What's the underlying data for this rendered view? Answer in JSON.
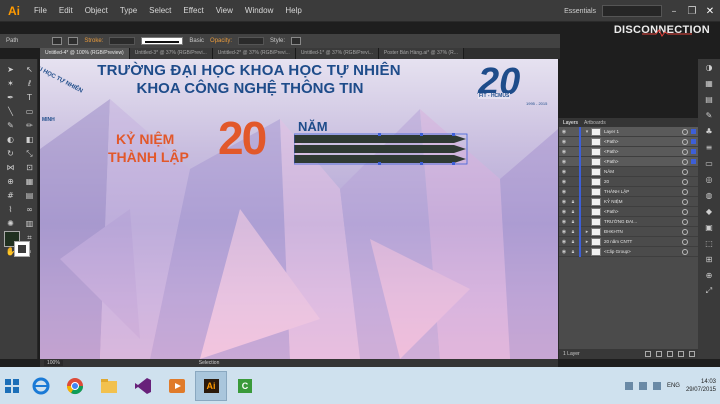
{
  "app": {
    "logo": "Ai",
    "menu": [
      "File",
      "Edit",
      "Object",
      "Type",
      "Select",
      "Effect",
      "View",
      "Window",
      "Help"
    ],
    "workspace": "Essentials",
    "overlay_brand": "DISCONNECTION"
  },
  "control_bar": {
    "object_type": "Path",
    "stroke_label": "Stroke:",
    "stroke_profile": "Basic",
    "opacity_label": "Opacity:",
    "style_label": "Style:"
  },
  "tabs": [
    {
      "label": "Untitled-4* @ 100% (RGB/Preview)",
      "active": true
    },
    {
      "label": "Untitled-3* @ 37% (RGB/Previ...",
      "active": false
    },
    {
      "label": "Untitled-2* @ 37% (RGB/Previ...",
      "active": false
    },
    {
      "label": "Untitled-1* @ 37% (RGB/Previ...",
      "active": false
    },
    {
      "label": "Poster Bán Hàng.ai* @ 37% (R...",
      "active": false
    }
  ],
  "canvas": {
    "seal_text": "ĐẠI HỌC TỰ NHIÊN",
    "seal_text2": "MINH",
    "university": "TRƯỜNG ĐẠI HỌC KHOA HỌC TỰ NHIÊN",
    "faculty": "KHOA CÔNG NGHỆ THÔNG TIN",
    "anniv_line1": "KỶ NIỆM",
    "anniv_line2": "THÀNH LẬP",
    "big_number": "20",
    "nam": "NĂM",
    "logo_number": "20",
    "logo_sub": "FIT - HCMUS",
    "logo_years": "1995 - 2015"
  },
  "status_bar": {
    "zoom": "100%",
    "tool": "Selection"
  },
  "layers_panel": {
    "tabs": [
      "Layers",
      "Artboards"
    ],
    "rows": [
      {
        "name": "Layer 1",
        "selected": true
      },
      {
        "name": "<Path>",
        "selected": true
      },
      {
        "name": "<Path>",
        "selected": true
      },
      {
        "name": "<Path>",
        "selected": true
      },
      {
        "name": "NĂM",
        "selected": false
      },
      {
        "name": "20",
        "selected": false
      },
      {
        "name": "THÀNH LẬP",
        "selected": false
      },
      {
        "name": "KỶ NIỆM",
        "selected": false
      },
      {
        "name": "<Path>",
        "selected": false
      },
      {
        "name": "TRƯỜNG ĐAI...",
        "selected": false
      },
      {
        "name": "ĐHKHTN",
        "selected": false
      },
      {
        "name": "20 năm CNTT",
        "selected": false
      },
      {
        "name": "<Clip Group>",
        "selected": false
      }
    ],
    "footer_count": "1 Layer"
  },
  "taskbar": {
    "apps": [
      "IE",
      "Chrome",
      "Explorer",
      "VS",
      "Media",
      "Ai",
      "C"
    ],
    "language": "ENG",
    "time": "14:03",
    "date": "29/07/2015"
  },
  "colors": {
    "ui_dark": "#3b3b3b",
    "brand_blue": "#1e4c8a",
    "brand_orange": "#e2582a",
    "selection_blue": "#3d5fd8"
  }
}
